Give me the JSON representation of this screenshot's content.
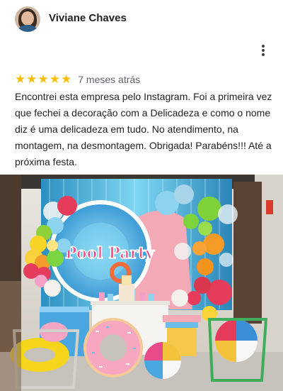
{
  "review": {
    "author": "Viviane Chaves",
    "rating": 5,
    "time_ago": "7 meses atrás",
    "text": "Encontrei esta empresa pelo Instagram.  Foi a primeira vez que fechei a decoração com a Delicadeza e como o nome diz é uma delicadeza em tudo. No atendimento, na montagem,  na desmontagem. Obrigada! Parabéns!!! Até a próxima festa."
  },
  "photo": {
    "sign_text": "Pool Party"
  },
  "icons": {
    "more": "more-vert-icon",
    "star": "star-icon"
  },
  "colors": {
    "star": "#fbbc04",
    "text": "#202124",
    "secondary_text": "#5f6368"
  }
}
